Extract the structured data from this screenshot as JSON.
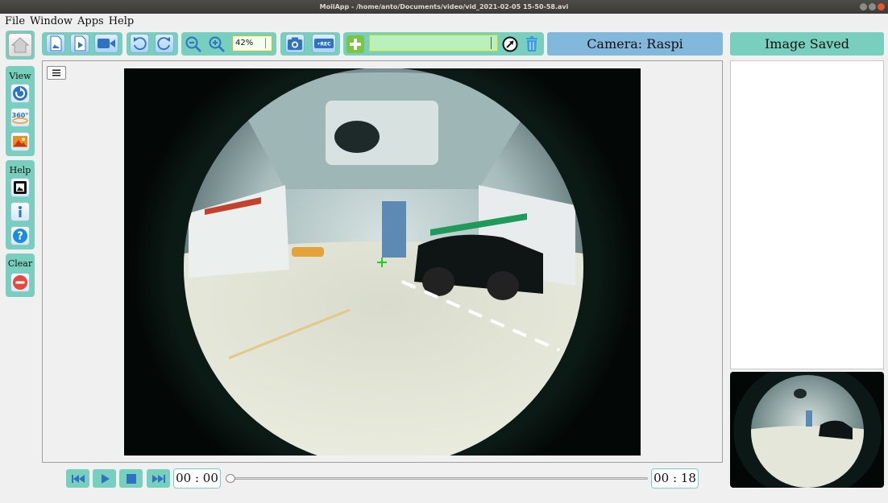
{
  "window": {
    "title": "MoilApp - /home/anto/Documents/video/vid_2021-02-05 15-50-58.avi"
  },
  "menubar": {
    "items": [
      {
        "label": "File"
      },
      {
        "label": "Window"
      },
      {
        "label": "Apps"
      },
      {
        "label": "Help"
      }
    ]
  },
  "toolbar": {
    "zoom_value": "42%",
    "source_combo_value": "",
    "icons": [
      "open-image-icon",
      "open-video-icon",
      "camera-stream-icon",
      "rotate-left-icon",
      "rotate-right-icon",
      "zoom-out-icon",
      "zoom-in-icon",
      "snapshot-icon",
      "record-icon",
      "add-icon",
      "anypoint-icon",
      "delete-icon"
    ],
    "record_badge": "•REC"
  },
  "camera_label": "Camera: Raspi",
  "saved_panel": {
    "title": "Image Saved"
  },
  "sidebar": {
    "view_label": "View",
    "help_label": "Help",
    "clear_label": "Clear",
    "pano_badge": "360°",
    "icons": [
      "home-icon",
      "reset-view-icon",
      "panorama-360-icon",
      "landscape-icon",
      "show-image-icon",
      "info-icon",
      "help-question-icon",
      "clear-icon"
    ]
  },
  "playback": {
    "current_time": "00 : 00",
    "total_time": "00 : 18",
    "progress": 0.0,
    "icons": [
      "skip-back-icon",
      "play-icon",
      "stop-icon",
      "skip-forward-icon"
    ]
  },
  "colors": {
    "accent_teal": "#78cfbd",
    "camera_blue": "#82b8dc",
    "crosshair_green": "#22cc22",
    "clear_red": "#e8473d",
    "title_bar": "#3c3b37"
  }
}
